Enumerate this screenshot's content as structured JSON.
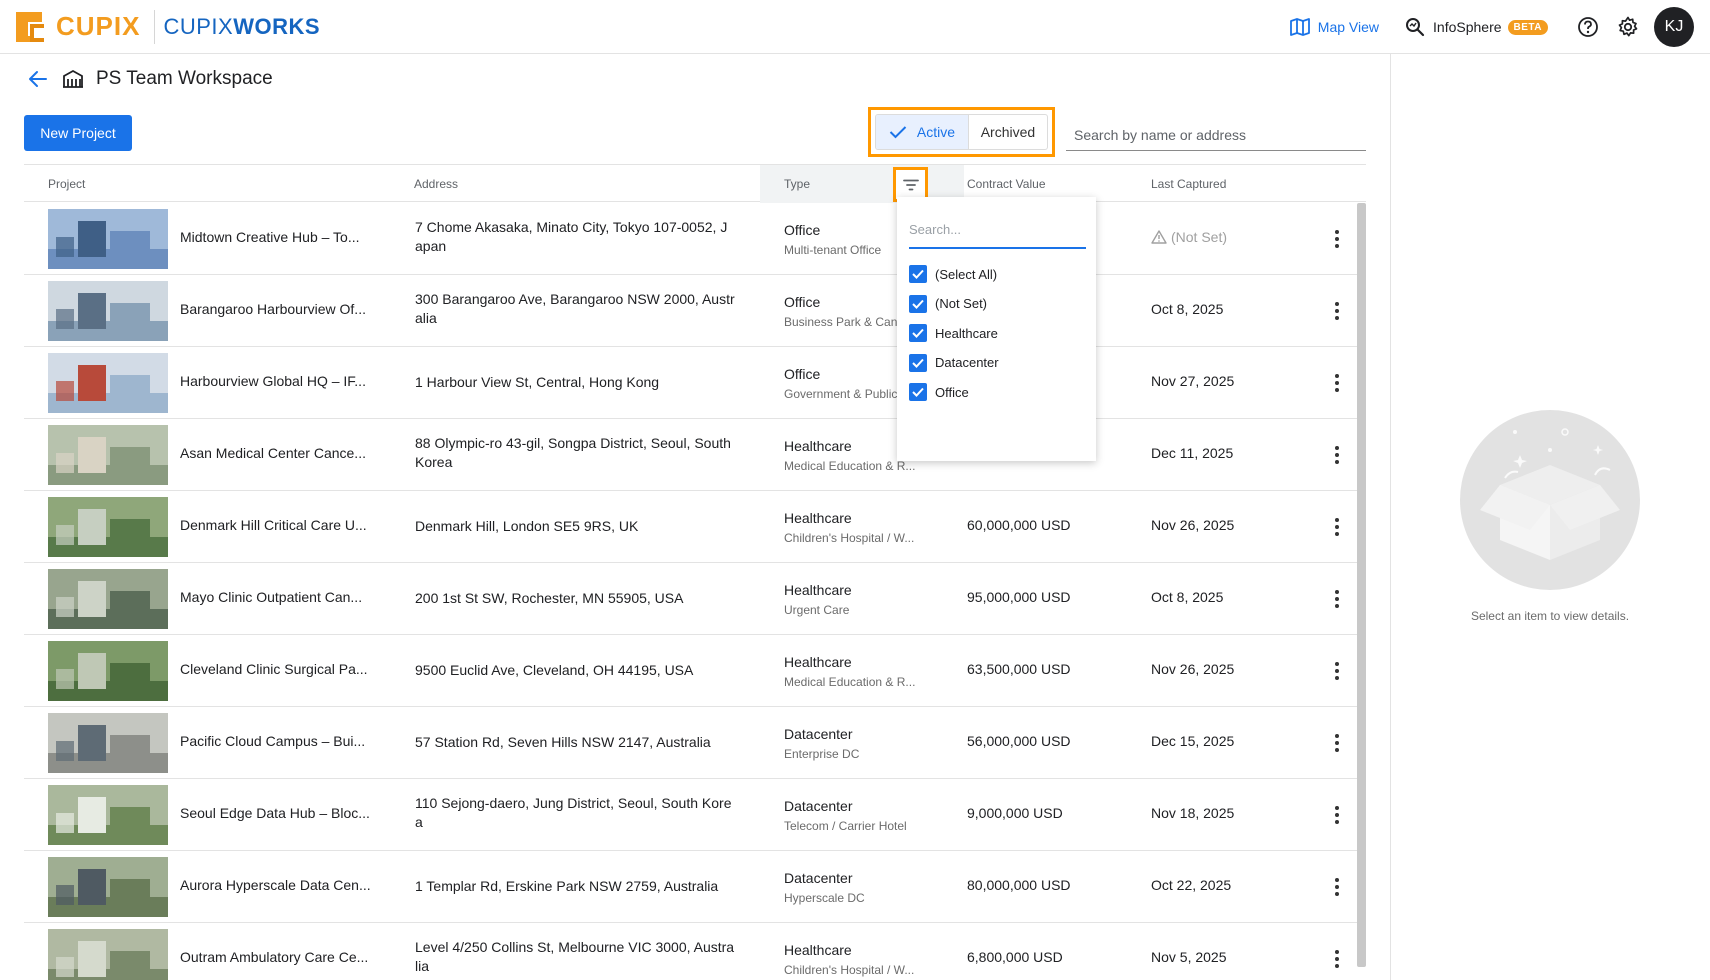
{
  "brand": {
    "logo_text": "CUPIX",
    "works_text_a": "CUPIX",
    "works_text_b": "WORKS"
  },
  "topnav": {
    "map_view": "Map View",
    "infosphere": "InfoSphere",
    "beta": "BETA",
    "avatar_initials": "KJ"
  },
  "workspace": {
    "title": "PS Team Workspace"
  },
  "toolbar": {
    "new_project": "New Project",
    "active": "Active",
    "archived": "Archived",
    "search_placeholder": "Search by name or address"
  },
  "columns": {
    "project": "Project",
    "address": "Address",
    "type": "Type",
    "contract_value": "Contract Value",
    "last_captured": "Last Captured"
  },
  "filter": {
    "search_placeholder": "Search...",
    "options": [
      "(Select All)",
      "(Not Set)",
      "Healthcare",
      "Datacenter",
      "Office"
    ]
  },
  "rows": [
    {
      "name": "Midtown Creative Hub – To...",
      "address": "7 Chome Akasaka, Minato City, Tokyo 107-0052, J apan",
      "type": "Office",
      "subtype": "Multi-tenant Office",
      "contract_value": "",
      "last_captured": "(Not Set)"
    },
    {
      "name": "Barangaroo Harbourview Of...",
      "address": "300 Barangaroo Ave, Barangaroo NSW 2000, Austr alia",
      "type": "Office",
      "subtype": "Business Park & Can",
      "contract_value": "",
      "last_captured": "Oct 8, 2025"
    },
    {
      "name": "Harbourview Global HQ – IF...",
      "address": "1 Harbour View St, Central, Hong Kong",
      "type": "Office",
      "subtype": "Government & Public",
      "contract_value": "",
      "last_captured": "Nov 27, 2025"
    },
    {
      "name": "Asan Medical Center Cance...",
      "address": "88 Olympic-ro 43-gil, Songpa District, Seoul, South Korea",
      "type": "Healthcare",
      "subtype": "Medical Education & R...",
      "contract_value": "",
      "last_captured": "Dec 11, 2025"
    },
    {
      "name": "Denmark Hill Critical Care U...",
      "address": "Denmark Hill, London SE5 9RS, UK",
      "type": "Healthcare",
      "subtype": "Children's Hospital / W...",
      "contract_value": "60,000,000 USD",
      "last_captured": "Nov 26, 2025"
    },
    {
      "name": "Mayo Clinic Outpatient Can...",
      "address": "200 1st St SW, Rochester, MN 55905, USA",
      "type": "Healthcare",
      "subtype": "Urgent Care",
      "contract_value": "95,000,000 USD",
      "last_captured": "Oct 8, 2025"
    },
    {
      "name": "Cleveland Clinic Surgical Pa...",
      "address": "9500 Euclid Ave, Cleveland, OH 44195, USA",
      "type": "Healthcare",
      "subtype": "Medical Education & R...",
      "contract_value": "63,500,000 USD",
      "last_captured": "Nov 26, 2025"
    },
    {
      "name": "Pacific Cloud Campus – Bui...",
      "address": "57 Station Rd, Seven Hills NSW 2147, Australia",
      "type": "Datacenter",
      "subtype": "Enterprise DC",
      "contract_value": "56,000,000 USD",
      "last_captured": "Dec 15, 2025"
    },
    {
      "name": "Seoul Edge Data Hub – Bloc...",
      "address": "110 Sejong-daero, Jung District, Seoul, South Kore a",
      "type": "Datacenter",
      "subtype": "Telecom / Carrier Hotel",
      "contract_value": "9,000,000 USD",
      "last_captured": "Nov 18, 2025"
    },
    {
      "name": "Aurora Hyperscale Data Cen...",
      "address": "1 Templar Rd, Erskine Park NSW 2759, Australia",
      "type": "Datacenter",
      "subtype": "Hyperscale DC",
      "contract_value": "80,000,000 USD",
      "last_captured": "Oct 22, 2025"
    },
    {
      "name": "Outram Ambulatory Care Ce...",
      "address": "Level 4/250 Collins St, Melbourne VIC 3000, Austra lia",
      "type": "Healthcare",
      "subtype": "Children's Hospital / W...",
      "contract_value": "6,800,000 USD",
      "last_captured": "Nov 5, 2025"
    }
  ],
  "detail_panel": {
    "empty_text": "Select an item to view details."
  },
  "colors": {
    "accent": "#1a73e8",
    "brand_orange": "#f39c1f",
    "highlight": "#ff9800"
  }
}
